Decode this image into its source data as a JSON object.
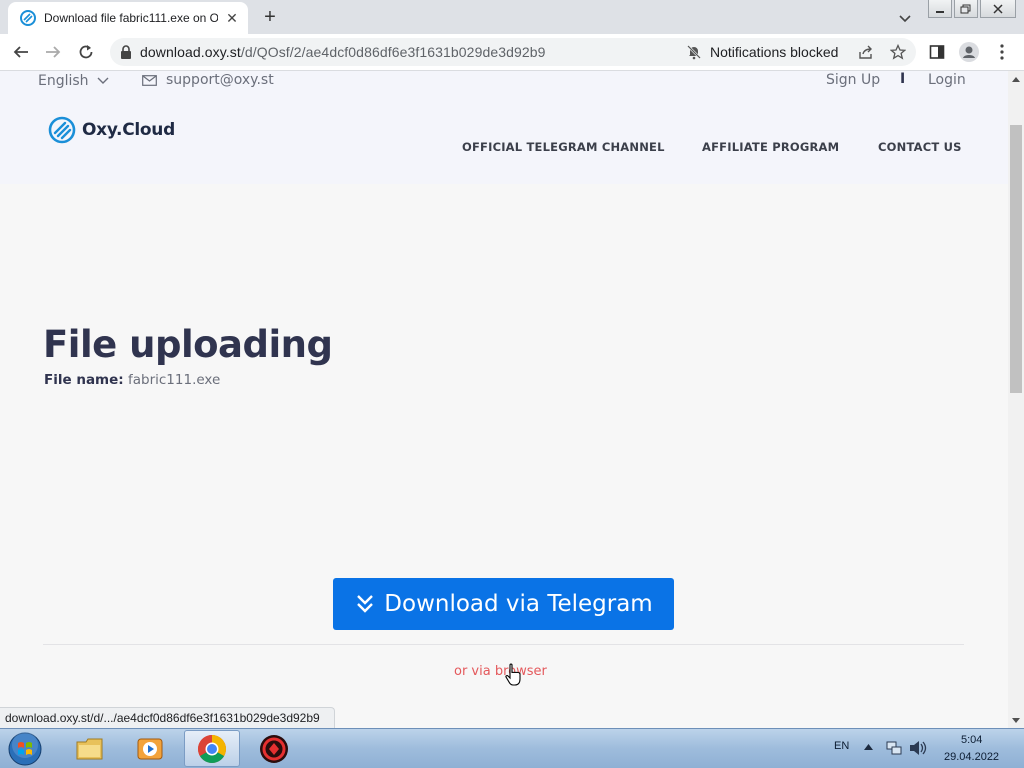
{
  "browser": {
    "tab_title": "Download file fabric111.exe on O",
    "tab_close": "✕",
    "new_tab": "+",
    "url_host": "download.oxy.st",
    "url_path": "/d/QOsf/2/ae4dcf0d86df6e3f1631b029de3d92b9",
    "notifications_label": "Notifications blocked",
    "status_url": "download.oxy.st/d/.../ae4dcf0d86df6e3f1631b029de3d92b9"
  },
  "site": {
    "language": "English",
    "support_email": "support@oxy.st",
    "sign_up": "Sign Up",
    "separator": "I",
    "login": "Login",
    "logo_text": "Oxy.Cloud",
    "nav": [
      "OFFICIAL TELEGRAM CHANNEL",
      "AFFILIATE PROGRAM",
      "CONTACT US"
    ]
  },
  "main": {
    "title": "File uploading",
    "file_name_label": "File name:",
    "file_name": "fabric111.exe",
    "download_button": "Download via Telegram",
    "browser_link": "or via browser"
  },
  "taskbar": {
    "language": "EN",
    "time": "5:04",
    "date": "29.04.2022"
  },
  "colors": {
    "accent": "#0a73e6",
    "link_red": "#e4595c",
    "heading": "#30344f"
  }
}
